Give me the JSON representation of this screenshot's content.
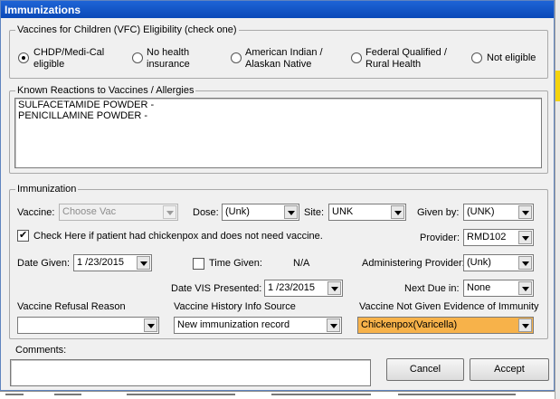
{
  "window": {
    "title": "Immunizations"
  },
  "vfc": {
    "legend": "Vaccines for Children (VFC) Eligibility (check one)",
    "options": [
      {
        "label": "CHDP/Medi-Cal eligible",
        "selected": true
      },
      {
        "label": "No health insurance",
        "selected": false
      },
      {
        "label": "American Indian / Alaskan Native",
        "selected": false
      },
      {
        "label": "Federal Qualified / Rural Health",
        "selected": false
      },
      {
        "label": "Not eligible",
        "selected": false
      }
    ]
  },
  "allergies": {
    "legend": "Known Reactions to Vaccines / Allergies",
    "lines": [
      "SULFACETAMIDE POWDER -",
      "PENICILLAMINE POWDER -"
    ]
  },
  "immunization": {
    "legend": "Immunization",
    "vaccine": {
      "label": "Vaccine:",
      "value": "Choose Vac"
    },
    "dose": {
      "label": "Dose:",
      "value": "(Unk)"
    },
    "site": {
      "label": "Site:",
      "value": "UNK"
    },
    "given_by": {
      "label": "Given by:",
      "value": "(UNK)"
    },
    "chickenpox_check": {
      "label": "Check Here if patient had chickenpox and does not need vaccine.",
      "checked": true
    },
    "provider": {
      "label": "Provider:",
      "value": "RMD102"
    },
    "date_given": {
      "label": "Date Given:",
      "value": "1 /23/2015"
    },
    "time_given": {
      "label": "Time Given:",
      "value": "N/A",
      "checked": false
    },
    "administering_provider": {
      "label": "Administering Provider:",
      "value": "(Unk)"
    },
    "date_vis": {
      "label": "Date VIS Presented:",
      "value": "1 /23/2015"
    },
    "next_due": {
      "label": "Next Due in:",
      "value": "None"
    },
    "refusal_reason": {
      "label": "Vaccine Refusal Reason",
      "value": ""
    },
    "history_source": {
      "label": "Vaccine History Info Source",
      "value": "New immunization record"
    },
    "not_given_evidence": {
      "label": "Vaccine Not Given Evidence of Immunity",
      "value": "Chickenpox(Varicella)"
    }
  },
  "comments": {
    "label": "Comments:",
    "value": ""
  },
  "buttons": {
    "cancel": "Cancel",
    "accept": "Accept"
  },
  "colors": {
    "titlebar": "#0a49b8",
    "highlight": "#f7b24a"
  }
}
